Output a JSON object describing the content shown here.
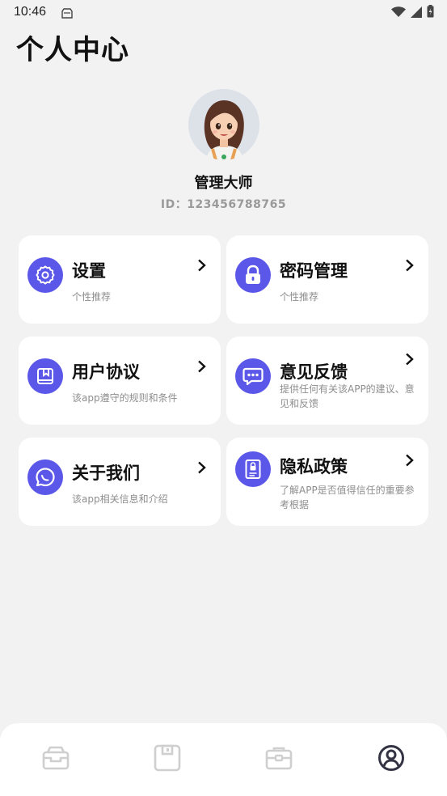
{
  "status": {
    "time": "10:46"
  },
  "page": {
    "title": "个人中心"
  },
  "profile": {
    "name": "管理大师",
    "id": "ID：123456788765"
  },
  "menu": [
    {
      "title": "设置",
      "desc": "个性推荐",
      "icon": "gear-icon"
    },
    {
      "title": "密码管理",
      "desc": "个性推荐",
      "icon": "lock-icon"
    },
    {
      "title": "用户协议",
      "desc": "该app遵守的规则和条件",
      "icon": "bookmark-book-icon"
    },
    {
      "title": "意见反馈",
      "desc": "提供任何有关该APP的建议、意见和反馈",
      "icon": "chat-bubble-icon"
    },
    {
      "title": "关于我们",
      "desc": "该app相关信息和介绍",
      "icon": "chat-circle-icon"
    },
    {
      "title": "隐私政策",
      "desc": "了解APP是否值得信任的重要参考根据",
      "icon": "privacy-document-icon"
    }
  ],
  "tabs": [
    {
      "icon": "inbox-tray-icon",
      "active": false
    },
    {
      "icon": "save-disk-icon",
      "active": false
    },
    {
      "icon": "briefcase-icon",
      "active": false
    },
    {
      "icon": "profile-icon",
      "active": true
    }
  ],
  "colors": {
    "accent": "#5b57e8",
    "background": "#f2f2f2",
    "card": "#ffffff",
    "inactive_tab": "#cfcfcf",
    "active_tab": "#333344"
  }
}
